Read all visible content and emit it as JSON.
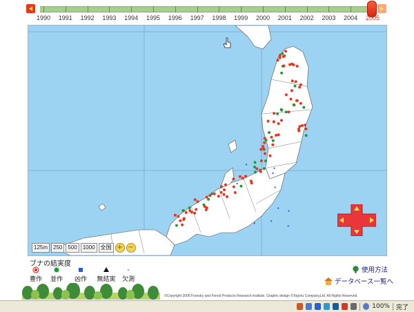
{
  "timeline": {
    "years": [
      "1990",
      "1991",
      "1992",
      "1993",
      "1994",
      "1995",
      "1996",
      "1997",
      "1998",
      "1999",
      "2000",
      "2001",
      "2002",
      "2003",
      "2004",
      "2005"
    ],
    "selected_year": "2005",
    "prev_icon": "left-arrow-icon",
    "next_icon": "right-arrow-icon"
  },
  "zoom": {
    "levels": [
      "125m",
      "250",
      "500",
      "1000",
      "全国"
    ],
    "zoom_in_icon": "zoom-in-icon",
    "zoom_out_icon": "zoom-out-icon"
  },
  "legend": {
    "title": "ブナの結実度",
    "items": [
      {
        "label": "豊作",
        "color": "#e8361e",
        "shape": "circle-ring"
      },
      {
        "label": "並作",
        "color": "#1e9a3a",
        "shape": "circle"
      },
      {
        "label": "凶作",
        "color": "#2a5fd0",
        "shape": "square"
      },
      {
        "label": "無結実",
        "color": "#111111",
        "shape": "triangle"
      },
      {
        "label": "欠測",
        "color": "#aaaaaa",
        "shape": "dot"
      }
    ]
  },
  "links": {
    "how_to_use": "使用方法",
    "database_list": "データベース一覧へ",
    "how_to_icon": "tree-icon",
    "database_icon": "home-icon"
  },
  "copyright": "©Copyright 2006 Forestry and Forest Products Research Institute. Graphic design ©Togoru Company,Ltd. All Rights Reserved.",
  "statusbar": {
    "zoom_level": "100%",
    "status_text": "完了"
  },
  "colors": {
    "sea": "#9cd3f2",
    "land": "#ffffff",
    "abundant": "#e8361e",
    "moderate": "#1e9a3a",
    "timeline_bar": "#a5cf8a"
  }
}
